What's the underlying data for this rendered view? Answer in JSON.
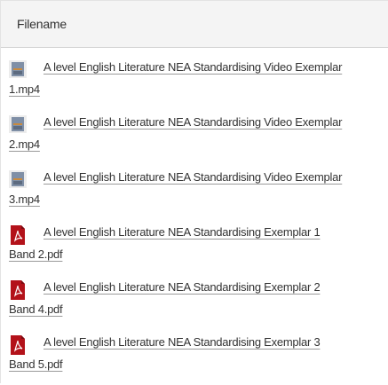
{
  "table": {
    "header": "Filename",
    "files": [
      {
        "line1": "A level English Literature NEA Standardising Video Exemplar",
        "line2": "1.mp4",
        "icon": "video-file-icon"
      },
      {
        "line1": "A level English Literature NEA Standardising Video Exemplar",
        "line2": "2.mp4",
        "icon": "video-file-icon"
      },
      {
        "line1": "A level English Literature NEA Standardising Video Exemplar",
        "line2": "3.mp4",
        "icon": "video-file-icon"
      },
      {
        "line1": "A level English Literature NEA Standardising Exemplar 1",
        "line2": "Band 2.pdf",
        "icon": "pdf-file-icon"
      },
      {
        "line1": "A level English Literature NEA Standardising Exemplar 2",
        "line2": "Band 4.pdf",
        "icon": "pdf-file-icon"
      },
      {
        "line1": "A level English Literature NEA Standardising Exemplar 3",
        "line2": "Band 5.pdf",
        "icon": "pdf-file-icon"
      }
    ]
  },
  "colors": {
    "video_icon": "#7f8fa6",
    "video_icon_accent": "#c98a3d",
    "pdf_icon": "#b3121a"
  }
}
